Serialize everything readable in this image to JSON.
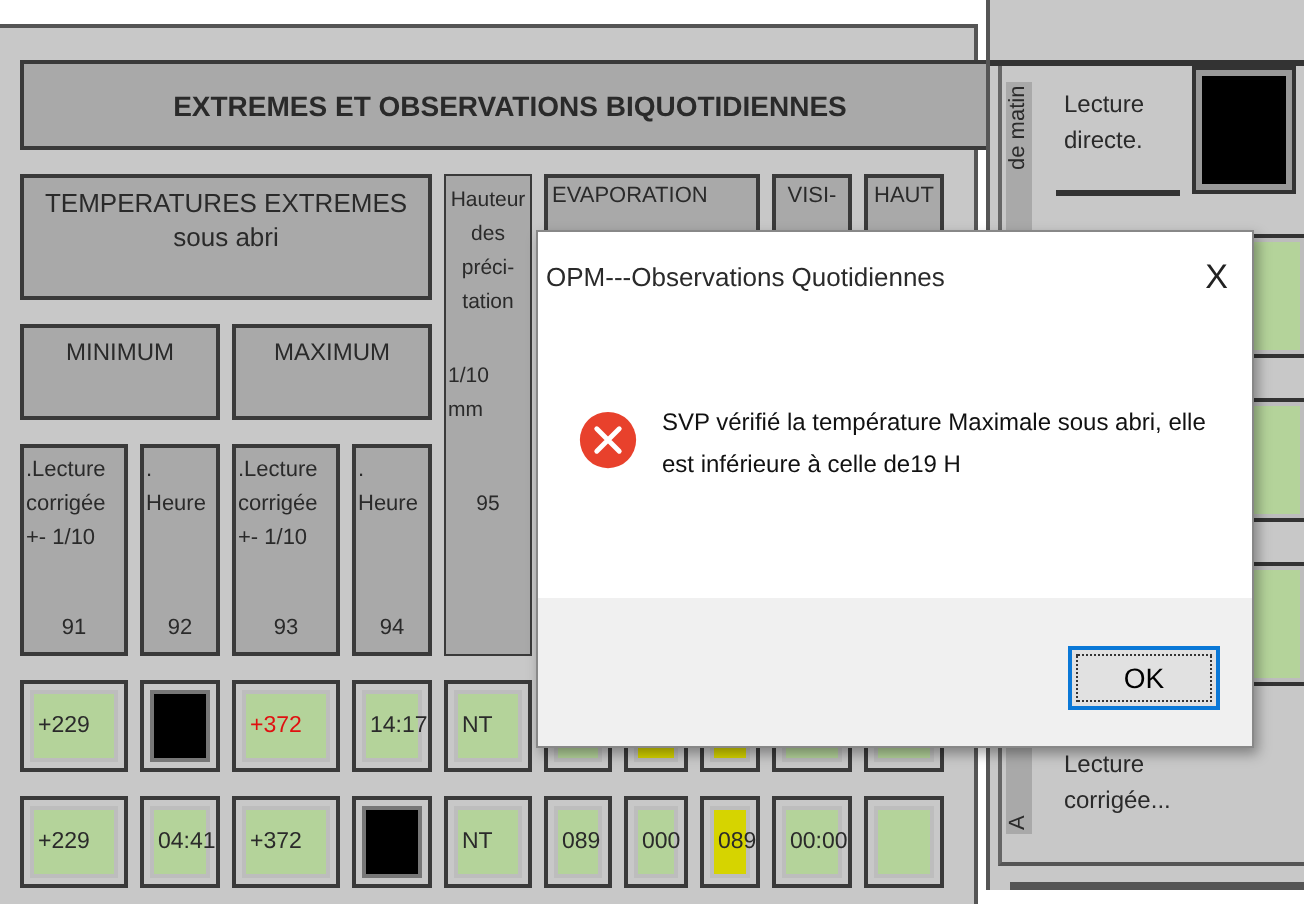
{
  "title": "EXTREMES ET OBSERVATIONS BIQUOTIDIENNES",
  "temperatures_header": {
    "lines": [
      "TEMPERATURES EXTREMES",
      "sous abri"
    ]
  },
  "precipitation_header": {
    "lines": [
      "Hauteur",
      "des",
      "préci-",
      "tation"
    ],
    "unit": [
      "1/10",
      "mm"
    ],
    "code": "95"
  },
  "evaporation_header": "EVAPORATION",
  "visibility_header": "VISI-",
  "height_header": "HAUT",
  "groups": [
    "MINIMUM",
    "MAXIMUM"
  ],
  "columns": [
    {
      "lines": [
        ".Lecture",
        "corrigée",
        "+- 1/10"
      ],
      "code": "91"
    },
    {
      "lines": [
        ".",
        "Heure"
      ],
      "code": "92"
    },
    {
      "lines": [
        ".Lecture",
        "corrigée",
        "+- 1/10"
      ],
      "code": "93"
    },
    {
      "lines": [
        ".",
        "Heure"
      ],
      "code": "94"
    }
  ],
  "rows": [
    {
      "cells": [
        {
          "kind": "field",
          "value": "+229"
        },
        {
          "kind": "blank"
        },
        {
          "kind": "field",
          "value": "+372",
          "alert": true
        },
        {
          "kind": "field",
          "value": "14:17"
        },
        {
          "kind": "field",
          "value": "NT"
        },
        {
          "kind": "field"
        },
        {
          "kind": "field",
          "highlighted": true
        },
        {
          "kind": "field",
          "highlighted": true
        },
        {
          "kind": "field"
        },
        {
          "kind": "field"
        }
      ]
    },
    {
      "cells": [
        {
          "kind": "field",
          "value": "+229"
        },
        {
          "kind": "field",
          "value": "04:41"
        },
        {
          "kind": "field",
          "value": "+372"
        },
        {
          "kind": "blank"
        },
        {
          "kind": "field",
          "value": "NT"
        },
        {
          "kind": "field",
          "value": "089"
        },
        {
          "kind": "field",
          "value": "000"
        },
        {
          "kind": "field",
          "value": "089",
          "highlighted": true
        },
        {
          "kind": "field",
          "value": "00:00"
        },
        {
          "kind": "field"
        }
      ]
    }
  ],
  "side_panel": {
    "morning_label": "de matin",
    "direct_label": "Lecture directe.",
    "strip_label": "A",
    "corrected_label": "Lecture corrigée..."
  },
  "dialog": {
    "title": "OPM---Observations Quotidiennes",
    "close": "X",
    "message": "SVP vérifié la température Maximale sous abri, elle est inférieure à celle de19 H",
    "button": "OK"
  }
}
